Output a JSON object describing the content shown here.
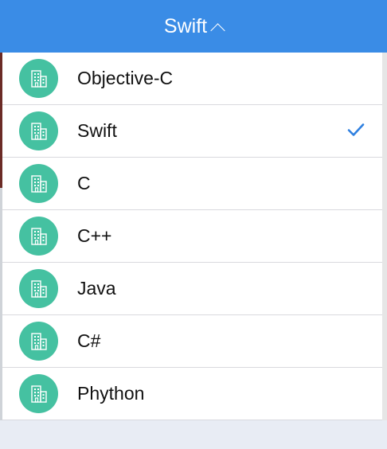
{
  "header": {
    "title": "Swift",
    "toggle_icon": "chevron-up-icon"
  },
  "list": {
    "items": [
      {
        "label": "Objective-C",
        "icon": "building-icon",
        "selected": false
      },
      {
        "label": "Swift",
        "icon": "building-icon",
        "selected": true
      },
      {
        "label": "C",
        "icon": "building-icon",
        "selected": false
      },
      {
        "label": "C++",
        "icon": "building-icon",
        "selected": false
      },
      {
        "label": "Java",
        "icon": "building-icon",
        "selected": false
      },
      {
        "label": "C#",
        "icon": "building-icon",
        "selected": false
      },
      {
        "label": "Phython",
        "icon": "building-icon",
        "selected": false
      }
    ]
  },
  "colors": {
    "header_bg": "#3a8ce6",
    "avatar_bg": "#45c1a1",
    "check": "#2f80e0",
    "divider": "#d9d9de"
  }
}
